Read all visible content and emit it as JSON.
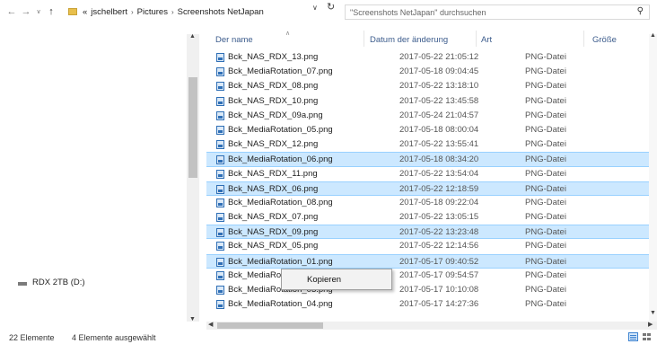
{
  "address_bar": {
    "overflow": "«",
    "crumbs": [
      "jschelbert",
      "Pictures",
      "Screenshots NetJapan"
    ],
    "separator": "›"
  },
  "search": {
    "placeholder": "\"Screenshots NetJapan\" durchsuchen"
  },
  "columns": {
    "name": "Der name",
    "date": "Datum der änderung",
    "type": "Art",
    "size": "Größe"
  },
  "files": [
    {
      "name": "Bck_NAS_RDX_13.png",
      "date": "2017-05-22 21:05:12",
      "type": "PNG-Datei",
      "selected": false
    },
    {
      "name": "Bck_MediaRotation_07.png",
      "date": "2017-05-18 09:04:45",
      "type": "PNG-Datei",
      "selected": false
    },
    {
      "name": "Bck_NAS_RDX_08.png",
      "date": "2017-05-22 13:18:10",
      "type": "PNG-Datei",
      "selected": false
    },
    {
      "name": "Bck_NAS_RDX_10.png",
      "date": "2017-05-22 13:45:58",
      "type": "PNG-Datei",
      "selected": false
    },
    {
      "name": "Bck_NAS_RDX_09a.png",
      "date": "2017-05-24 21:04:57",
      "type": "PNG-Datei",
      "selected": false
    },
    {
      "name": "Bck_MediaRotation_05.png",
      "date": "2017-05-18 08:00:04",
      "type": "PNG-Datei",
      "selected": false
    },
    {
      "name": "Bck_NAS_RDX_12.png",
      "date": "2017-05-22 13:55:41",
      "type": "PNG-Datei",
      "selected": false
    },
    {
      "name": "Bck_MediaRotation_06.png",
      "date": "2017-05-18 08:34:20",
      "type": "PNG-Datei",
      "selected": true
    },
    {
      "name": "Bck_NAS_RDX_11.png",
      "date": "2017-05-22 13:54:04",
      "type": "PNG-Datei",
      "selected": false
    },
    {
      "name": "Bck_NAS_RDX_06.png",
      "date": "2017-05-22 12:18:59",
      "type": "PNG-Datei",
      "selected": true
    },
    {
      "name": "Bck_MediaRotation_08.png",
      "date": "2017-05-18 09:22:04",
      "type": "PNG-Datei",
      "selected": false
    },
    {
      "name": "Bck_NAS_RDX_07.png",
      "date": "2017-05-22 13:05:15",
      "type": "PNG-Datei",
      "selected": false
    },
    {
      "name": "Bck_NAS_RDX_09.png",
      "date": "2017-05-22 13:23:48",
      "type": "PNG-Datei",
      "selected": true
    },
    {
      "name": "Bck_NAS_RDX_05.png",
      "date": "2017-05-22 12:14:56",
      "type": "PNG-Datei",
      "selected": false
    },
    {
      "name": "Bck_MediaRotation_01.png",
      "date": "2017-05-17 09:40:52",
      "type": "PNG-Datei",
      "selected": true
    },
    {
      "name": "Bck_MediaRotation_02.png",
      "date": "2017-05-17 09:54:57",
      "type": "PNG-Datei",
      "selected": false
    },
    {
      "name": "Bck_MediaRotation_03.png",
      "date": "2017-05-17 10:10:08",
      "type": "PNG-Datei",
      "selected": false
    },
    {
      "name": "Bck_MediaRotation_04.png",
      "date": "2017-05-17 14:27:36",
      "type": "PNG-Datei",
      "selected": false
    }
  ],
  "nav_pane": {
    "drive_label": "RDX 2TB (D:)"
  },
  "context_menu": {
    "items": [
      "Kopieren"
    ]
  },
  "status": {
    "item_count": "22 Elemente",
    "selection": "4 Elemente ausgewählt"
  },
  "icons": {
    "back": "back-arrow-icon",
    "forward": "forward-arrow-icon",
    "recent": "chevron-down-icon",
    "up": "up-arrow-icon",
    "refresh": "refresh-icon",
    "search": "search-icon"
  },
  "colors": {
    "selection": "#cce8ff",
    "selection_border": "#99d1ff",
    "header_text": "#3c5c8c"
  }
}
